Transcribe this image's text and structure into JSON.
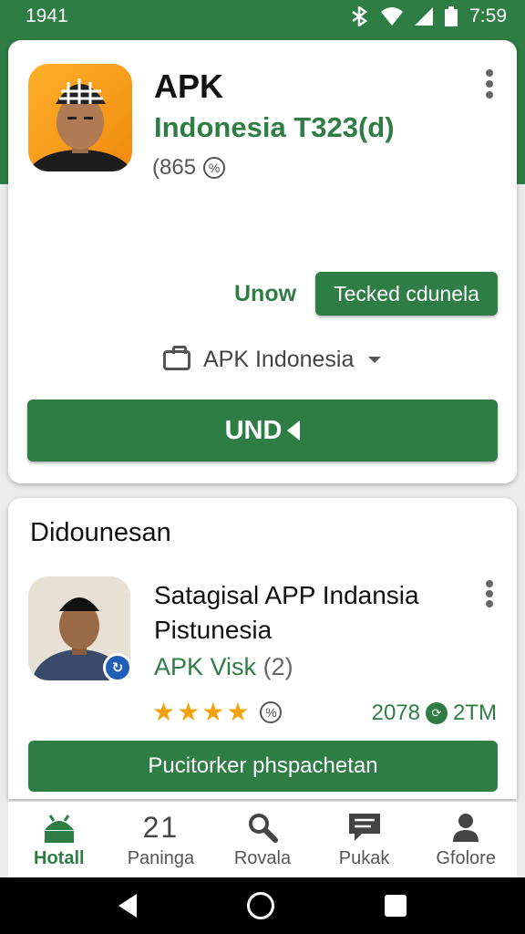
{
  "status_bar": {
    "time_left": "1941",
    "time_right": "7:59"
  },
  "card1": {
    "title": "APK",
    "subtitle": "Indonesia T323(d)",
    "meta": "(865",
    "unow_label": "Unow",
    "tecked_button": "Tecked cdunela",
    "dropdown_value": "APK Indonesia",
    "main_button": "UND"
  },
  "card2": {
    "section_title": "Didounesan",
    "app_title_line1": "Satagisal APP Indansia",
    "app_title_line2": "Pistunesia",
    "app_sub": "APK Visk",
    "app_sub_count": "(2)",
    "rating_stars": 4,
    "stat_left": "2078",
    "stat_right": "2TM",
    "button": "Pucitorker phspachetan"
  },
  "bottom_nav": [
    {
      "label": "Hotall",
      "icon": "android-icon",
      "active": true
    },
    {
      "label": "Paninga",
      "icon": "number-icon",
      "number": "21"
    },
    {
      "label": "Rovala",
      "icon": "search-icon"
    },
    {
      "label": "Pukak",
      "icon": "message-icon"
    },
    {
      "label": "Gfolore",
      "icon": "person-icon"
    }
  ],
  "colors": {
    "brand_green": "#2e7d45",
    "star": "#f2a20c",
    "badge_blue": "#1f5fb8"
  }
}
